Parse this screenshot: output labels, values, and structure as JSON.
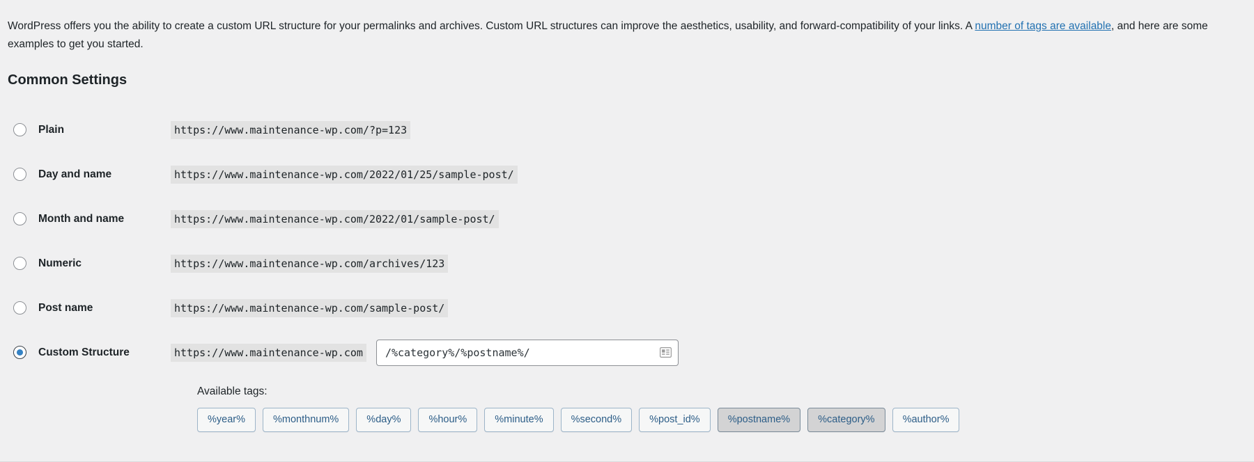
{
  "intro": {
    "text_before_link": "WordPress offers you the ability to create a custom URL structure for your permalinks and archives. Custom URL structures can improve the aesthetics, usability, and forward-compatibility of your links. A ",
    "link_text": "number of tags are available",
    "text_after_link": ", and here are some examples to get you started.",
    "link_color": "#2271b1"
  },
  "section": {
    "title": "Common Settings"
  },
  "options": [
    {
      "label": "Plain",
      "example": "https://www.maintenance-wp.com/?p=123",
      "selected": false
    },
    {
      "label": "Day and name",
      "example": "https://www.maintenance-wp.com/2022/01/25/sample-post/",
      "selected": false
    },
    {
      "label": "Month and name",
      "example": "https://www.maintenance-wp.com/2022/01/sample-post/",
      "selected": false
    },
    {
      "label": "Numeric",
      "example": "https://www.maintenance-wp.com/archives/123",
      "selected": false
    },
    {
      "label": "Post name",
      "example": "https://www.maintenance-wp.com/sample-post/",
      "selected": false
    }
  ],
  "custom_structure": {
    "label": "Custom Structure",
    "selected": true,
    "url_prefix": "https://www.maintenance-wp.com",
    "input_value": "/%category%/%postname%/",
    "input_placeholder": "",
    "autofill_icon": "form-autofill-icon"
  },
  "available_tags": {
    "label": "Available tags:",
    "tags": [
      {
        "name": "%year%",
        "active": false
      },
      {
        "name": "%monthnum%",
        "active": false
      },
      {
        "name": "%day%",
        "active": false
      },
      {
        "name": "%hour%",
        "active": false
      },
      {
        "name": "%minute%",
        "active": false
      },
      {
        "name": "%second%",
        "active": false
      },
      {
        "name": "%post_id%",
        "active": false
      },
      {
        "name": "%postname%",
        "active": true
      },
      {
        "name": "%category%",
        "active": true
      },
      {
        "name": "%author%",
        "active": false
      }
    ]
  },
  "colors": {
    "background": "#f0f0f1",
    "accent": "#2271b1",
    "radio_fill": "#3582c4",
    "code_bg": "#e2e2e2",
    "tag_border": "#9cb4c8",
    "tag_active_bg": "#d3d3d4"
  }
}
